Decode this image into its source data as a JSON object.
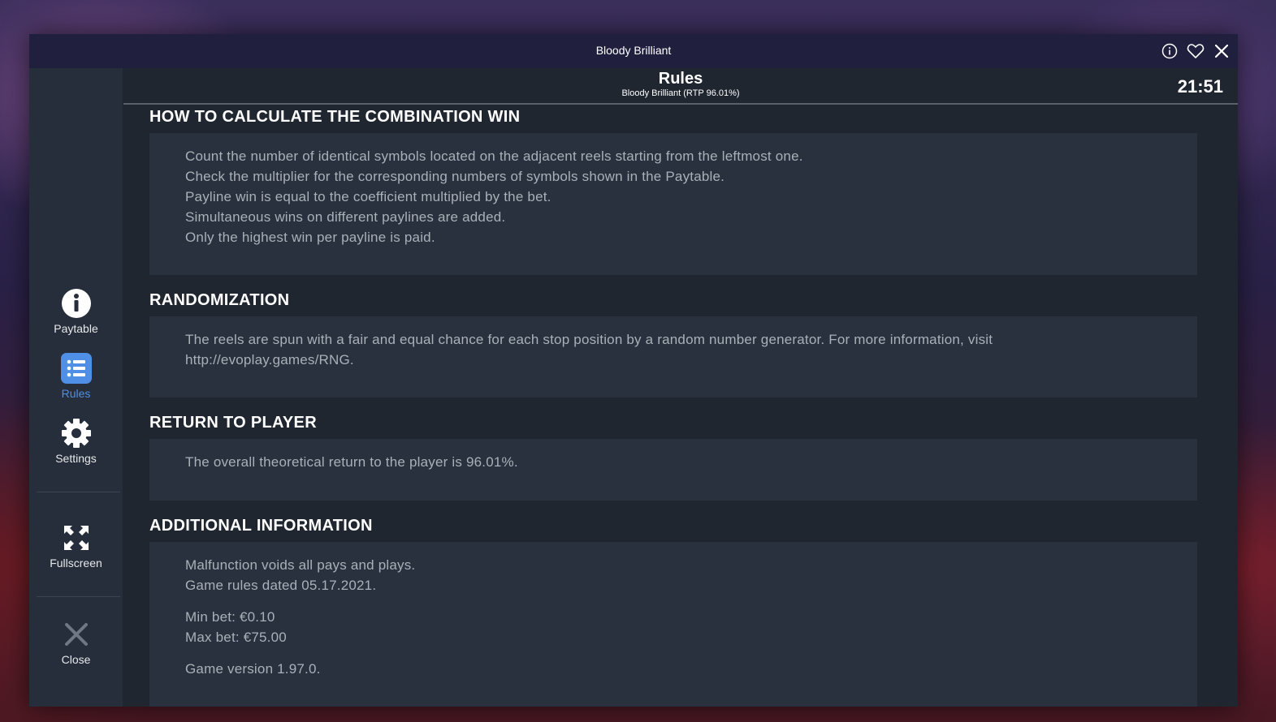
{
  "window": {
    "title": "Bloody Brilliant"
  },
  "header": {
    "title": "Rules",
    "subtitle": "Bloody Brilliant (RTP 96.01%)",
    "clock": "21:51"
  },
  "sidebar": {
    "items": [
      {
        "label": "Paytable",
        "icon": "info-icon"
      },
      {
        "label": "Rules",
        "icon": "list-icon",
        "active": true
      },
      {
        "label": "Settings",
        "icon": "gear-icon"
      },
      {
        "label": "Fullscreen",
        "icon": "fullscreen-icon"
      },
      {
        "label": "Close",
        "icon": "close-icon"
      }
    ]
  },
  "sections": {
    "combination": {
      "title": "HOW TO CALCULATE THE COMBINATION WIN",
      "lines": [
        "Count the number of identical symbols located on the adjacent reels starting from the leftmost one.",
        "Check the multiplier for the corresponding numbers of symbols shown in the Paytable.",
        "Payline win is equal to the coefficient multiplied by the bet.",
        "Simultaneous wins on different paylines are added.",
        "Only the highest win per payline is paid."
      ]
    },
    "randomization": {
      "title": "RANDOMIZATION",
      "lines": [
        "The reels are spun with a fair and equal chance for each stop position by a random number generator. For more information, visit",
        "http://evoplay.games/RNG."
      ]
    },
    "rtp": {
      "title": "RETURN TO PLAYER",
      "lines": [
        "The overall theoretical return to the player is 96.01%."
      ]
    },
    "additional": {
      "title": "ADDITIONAL INFORMATION",
      "lines": [
        "Malfunction voids all pays and plays.",
        "Game rules dated 05.17.2021.",
        "Min bet: €0.10",
        "Max bet: €75.00",
        "Game version 1.97.0."
      ]
    }
  },
  "colors": {
    "accent": "#4f8fe6",
    "panel": "#28313d",
    "background": "#1f2630",
    "titlebar": "#20203e"
  }
}
